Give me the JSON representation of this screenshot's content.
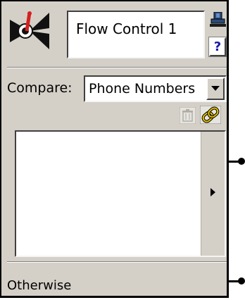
{
  "title": "Flow Control 1",
  "help_label": "?",
  "compare": {
    "label": "Compare:",
    "selected": "Phone Numbers"
  },
  "otherwise_label": "Otherwise",
  "icons": {
    "logo": "flow-control-icon",
    "stamp": "stamp-icon",
    "help": "help-icon",
    "dropdown": "chevron-down-icon",
    "delete": "trash-icon",
    "link": "chain-link-icon",
    "scroll": "triangle-right-icon"
  },
  "colors": {
    "panel": "#d4d0c8",
    "logo_accent": "#d42020",
    "link_icon": "#e0c000",
    "help_text": "#1a1aa0"
  }
}
